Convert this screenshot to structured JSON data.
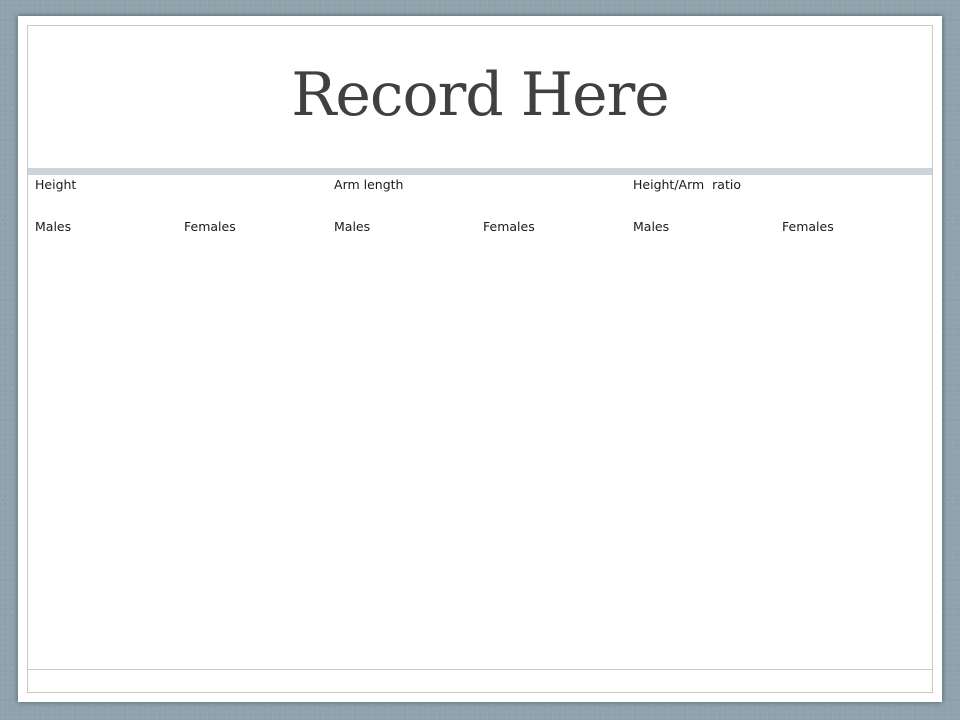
{
  "slide": {
    "title": "Record Here"
  },
  "table": {
    "groups": [
      "Height",
      "Arm length",
      "Height/Arm  ratio"
    ],
    "subheaders": [
      "Males",
      "Females",
      "Males",
      "Females",
      "Males",
      "Females"
    ]
  },
  "colors": {
    "background": "#8fa3ad",
    "slide": "#ffffff",
    "title": "#404040",
    "band": "#cbd4d8"
  }
}
